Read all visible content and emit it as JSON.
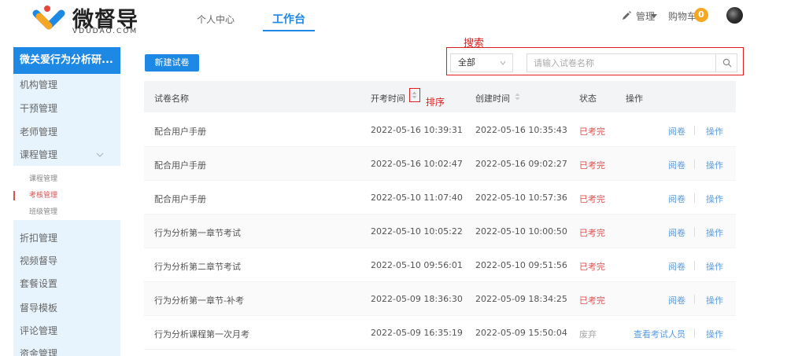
{
  "header": {
    "logo_text": "微督导",
    "logo_sub": "VDUDAO.COM",
    "nav": [
      {
        "label": "个人中心"
      },
      {
        "label": "工作台"
      }
    ],
    "manage_label": "管理",
    "cart_label": "购物车",
    "cart_count": "0"
  },
  "sidebar": {
    "title": "微关爱行为分析研...",
    "items": [
      {
        "label": "机构管理"
      },
      {
        "label": "干预管理"
      },
      {
        "label": "老师管理"
      },
      {
        "label": "课程管理"
      },
      {
        "label": "折扣管理"
      },
      {
        "label": "视频督导"
      },
      {
        "label": "套餐设置"
      },
      {
        "label": "督导模板"
      },
      {
        "label": "评论管理"
      },
      {
        "label": "资金管理"
      }
    ],
    "sub_items": [
      {
        "label": "课程管理"
      },
      {
        "label": "考核管理"
      },
      {
        "label": "班级管理"
      }
    ]
  },
  "toolbar": {
    "new_button": "新建试卷",
    "search_annotation": "搜索",
    "select_value": "全部",
    "search_placeholder": "请输入试卷名称"
  },
  "table": {
    "headers": {
      "name": "试卷名称",
      "start": "开考时间",
      "create": "创建时间",
      "status": "状态",
      "ops": "操作"
    },
    "sort_annotation": "排序",
    "rows": [
      {
        "name": "配合用户手册",
        "start": "2022-05-16 10:39:31",
        "create": "2022-05-16 10:35:43",
        "status": "已考完",
        "view": "阅卷",
        "op": "操作"
      },
      {
        "name": "配合用户手册",
        "start": "2022-05-16 10:02:47",
        "create": "2022-05-16 09:02:27",
        "status": "已考完",
        "view": "阅卷",
        "op": "操作"
      },
      {
        "name": "配合用户手册",
        "start": "2022-05-10 11:07:40",
        "create": "2022-05-10 10:57:36",
        "status": "已考完",
        "view": "阅卷",
        "op": "操作"
      },
      {
        "name": "行为分析第一章节考试",
        "start": "2022-05-10 10:05:22",
        "create": "2022-05-10 10:00:50",
        "status": "已考完",
        "view": "阅卷",
        "op": "操作"
      },
      {
        "name": "行为分析第二章节考试",
        "start": "2022-05-10 09:56:01",
        "create": "2022-05-10 09:51:56",
        "status": "已考完",
        "view": "阅卷",
        "op": "操作"
      },
      {
        "name": "行为分析第一章节-补考",
        "start": "2022-05-09 18:36:30",
        "create": "2022-05-09 18:34:25",
        "status": "已考完",
        "view": "阅卷",
        "op": "操作"
      },
      {
        "name": "行为分析课程第一次月考",
        "start": "2022-05-09 16:35:19",
        "create": "2022-05-09 15:50:04",
        "status": "废弃",
        "view": "查看考试人员",
        "op": "操作"
      }
    ]
  },
  "colors": {
    "accent": "#1e88e5",
    "status_done": "#e05050",
    "status_discard": "#aaaaaa",
    "annotation": "#e02020"
  }
}
